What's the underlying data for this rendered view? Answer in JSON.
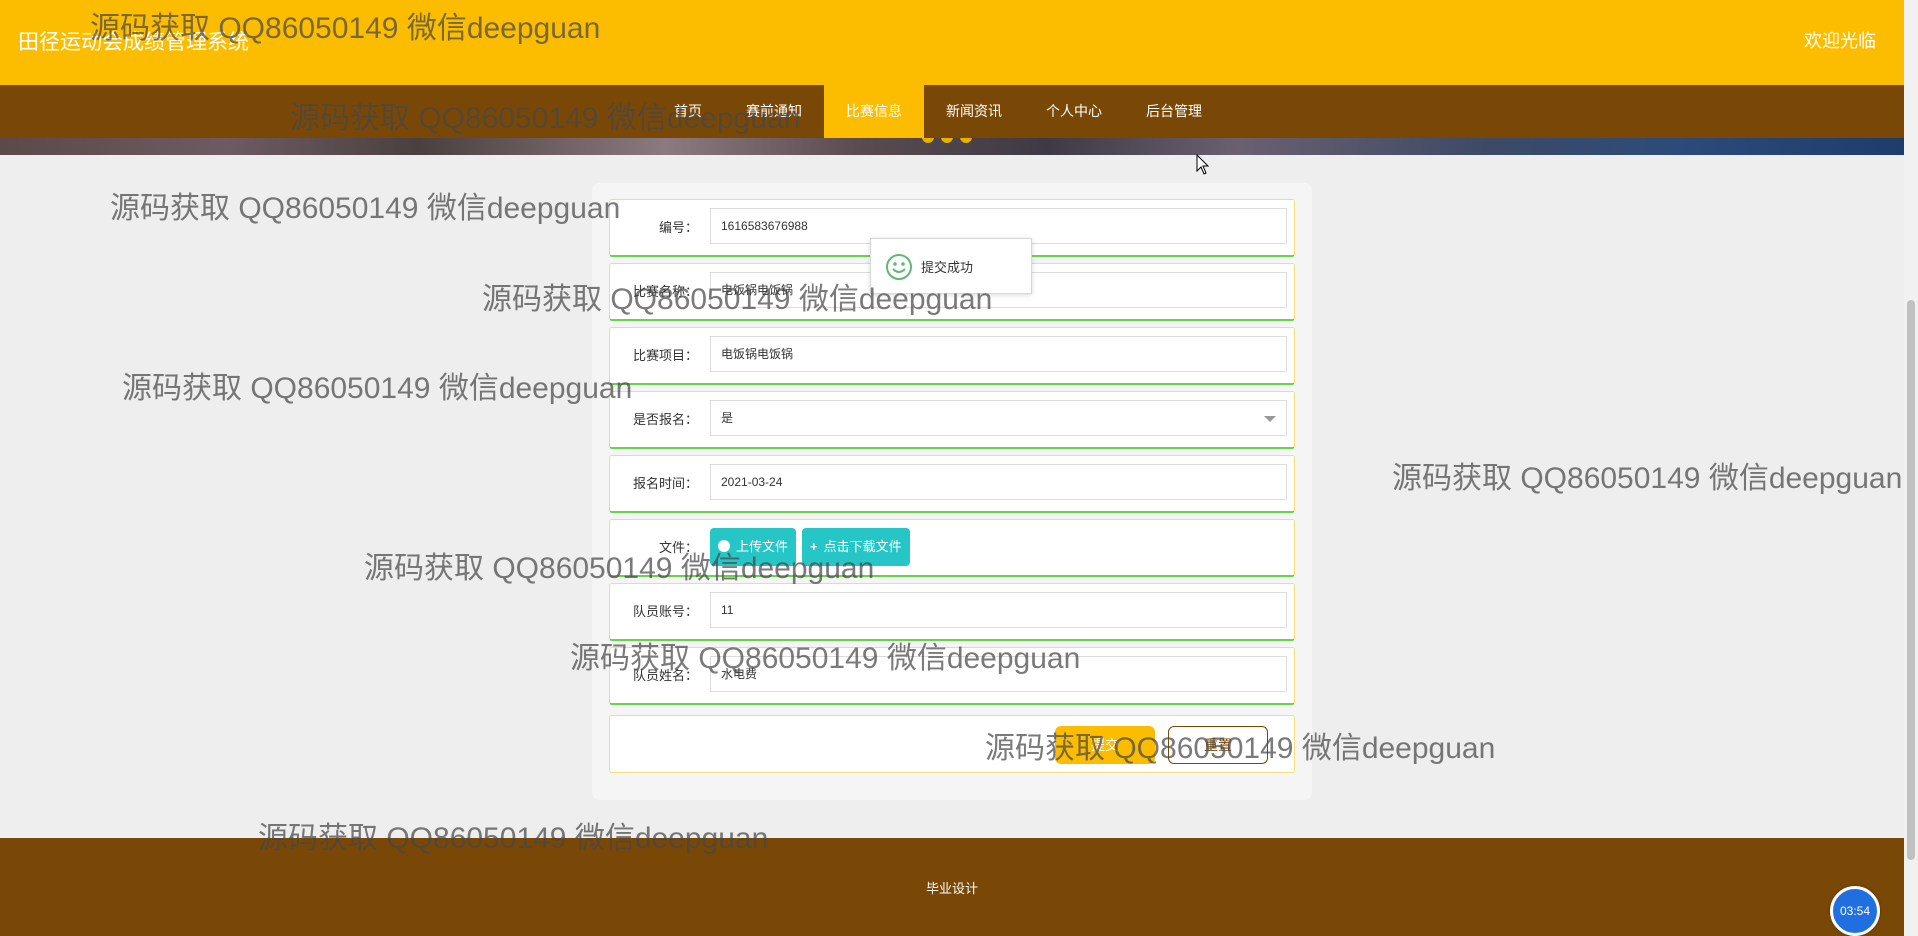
{
  "header": {
    "site_title": "田径运动会成绩管理系统",
    "welcome": "欢迎光临"
  },
  "nav": {
    "items": [
      {
        "label": "首页"
      },
      {
        "label": "赛前通知"
      },
      {
        "label": "比赛信息",
        "active": true
      },
      {
        "label": "新闻资讯"
      },
      {
        "label": "个人中心"
      },
      {
        "label": "后台管理"
      }
    ]
  },
  "form": {
    "fields": [
      {
        "label": "编号：",
        "value": "1616583676988"
      },
      {
        "label": "比赛名称：",
        "value": "电饭锅电饭锅"
      },
      {
        "label": "比赛项目：",
        "value": "电饭锅电饭锅"
      },
      {
        "label": "是否报名：",
        "value": "是"
      },
      {
        "label": "报名时间：",
        "value": "2021-03-24"
      },
      {
        "label": "文件：",
        "value": ""
      },
      {
        "label": "队员账号：",
        "value": "11"
      },
      {
        "label": "队员姓名：",
        "value": "水电费"
      }
    ],
    "upload_label": "上传文件",
    "download_label": "点击下载文件",
    "submit_label": "提交",
    "reset_label": "重置"
  },
  "toast": {
    "message": "提交成功"
  },
  "footer": {
    "text": "毕业设计"
  },
  "clock": {
    "time": "03:54"
  },
  "watermark": {
    "text": "源码获取 QQ86050149 微信deepguan"
  },
  "colors": {
    "primary": "#fcbd00",
    "nav_brown": "#7a4806",
    "upload_teal": "#27c6c6",
    "field_border_bottom": "#6ad14a"
  },
  "icons": [
    "smile-icon",
    "mouse-cursor-icon",
    "upload-icon",
    "plus-icon",
    "dropdown-caret-icon"
  ]
}
